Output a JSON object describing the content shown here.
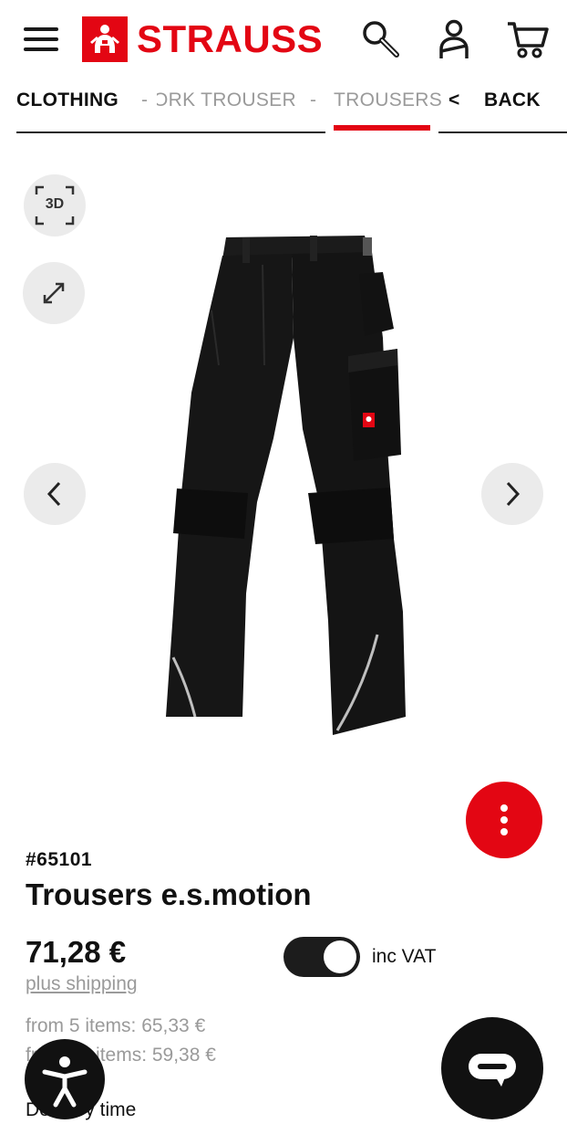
{
  "header": {
    "brand": "STRAUSS",
    "icons": [
      "menu-icon",
      "search-icon",
      "account-icon",
      "cart-icon"
    ]
  },
  "breadcrumb": {
    "item1": "CLOTHING",
    "sep1": "-",
    "item2": "ORK TROUSERS",
    "sep2": "-",
    "item3": "TROUSERS",
    "back_arrow": "<",
    "back": "BACK"
  },
  "gallery": {
    "btn_3d": "3D",
    "icons": [
      "3d-view-icon",
      "expand-icon",
      "chevron-left-icon",
      "chevron-right-icon"
    ]
  },
  "product": {
    "sku": "#65101",
    "title": "Trousers e.s.motion",
    "price": "71,28 €",
    "shipping": "plus shipping",
    "vat_label": "inc VAT",
    "vat_toggle_on": true,
    "tier1": "from 5 items: 65,33 €",
    "tier2": "from 10 items: 59,38 €",
    "delivery": "Delivery time"
  },
  "colors": {
    "brand_red": "#e30613",
    "dark": "#1a1a1a",
    "muted": "#9a9a9a",
    "button_bg": "#ebebeb"
  }
}
